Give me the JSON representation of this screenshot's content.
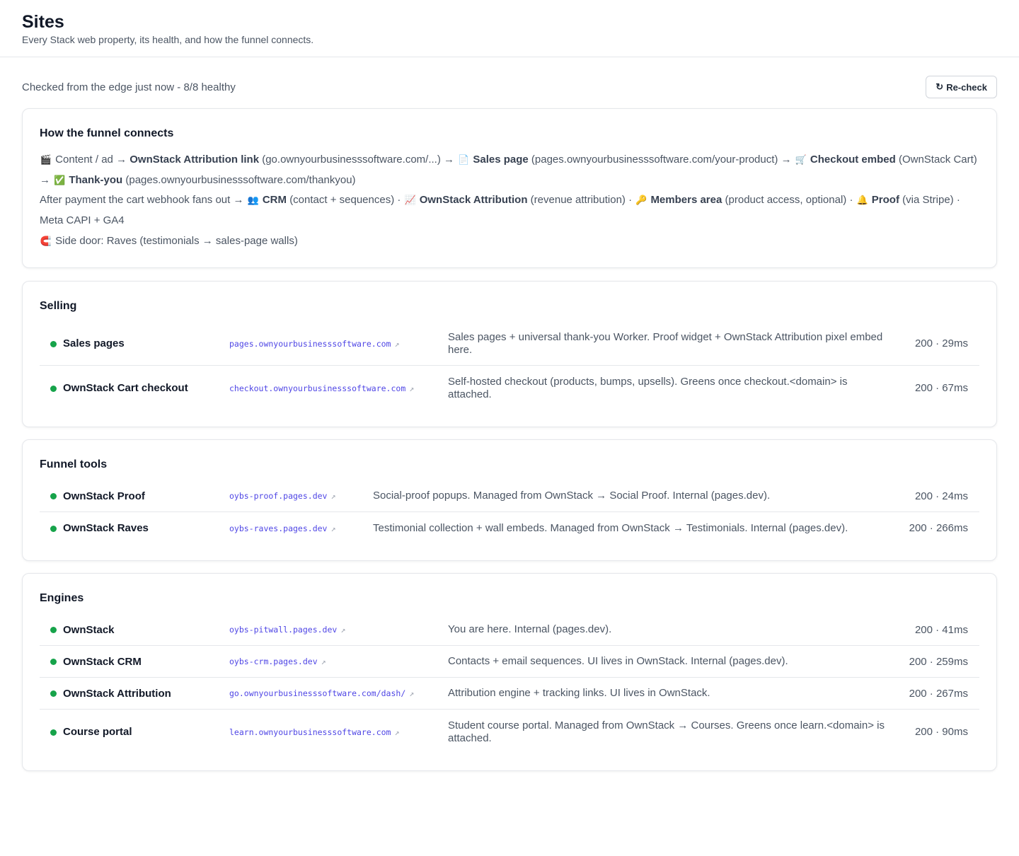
{
  "header": {
    "title": "Sites",
    "subtitle": "Every Stack web property, its health, and how the funnel connects."
  },
  "status": {
    "text": "Checked from the edge just now - 8/8 healthy",
    "recheck_label": "Re-check",
    "recheck_icon": "↻"
  },
  "funnel": {
    "title": "How the funnel connects",
    "l1_icon": "🎬",
    "l1_a": "Content / ad",
    "l1_b_bold": "OwnStack Attribution link",
    "l1_b_rest": "(go.ownyourbusinesssoftware.com/...)",
    "l1_c_icon": "📄",
    "l1_c_bold": "Sales page",
    "l1_c_rest": "(pages.ownyourbusinesssoftware.com/your-product)",
    "l1_d_icon": "🛒",
    "l1_d_bold": "Checkout embed",
    "l1_d_rest": "(OwnStack Cart)",
    "l1_e_icon": "✅",
    "l1_e_bold": "Thank-you",
    "l1_e_rest": "(pages.ownyourbusinesssoftware.com/thankyou)",
    "l2_a": "After payment the cart webhook fans out",
    "l2_b_icon": "👥",
    "l2_b_bold": "CRM",
    "l2_b_rest": "(contact + sequences)",
    "l2_c_icon": "📈",
    "l2_c_bold": "OwnStack Attribution",
    "l2_c_rest": "(revenue attribution)",
    "l2_d_icon": "🔑",
    "l2_d_bold": "Members area",
    "l2_d_rest": "(product access, optional)",
    "l2_e_icon": "🔔",
    "l2_e_bold": "Proof",
    "l2_e_rest": "(via Stripe)",
    "l2_f": "Meta CAPI + GA4",
    "l3_icon": "🧲",
    "l3_text": "Side door: Raves (testimonials → sales-page walls)"
  },
  "sections": {
    "selling": {
      "title": "Selling",
      "rows": [
        {
          "name": "Sales pages",
          "url": "pages.ownyourbusinesssoftware.com",
          "desc": "Sales pages + universal thank-you Worker. Proof widget + OwnStack Attribution pixel embed here.",
          "meta": "200 · 29ms"
        },
        {
          "name": "OwnStack Cart checkout",
          "url": "checkout.ownyourbusinesssoftware.com",
          "desc": "Self-hosted checkout (products, bumps, upsells). Greens once checkout.<domain> is attached.",
          "meta": "200 · 67ms"
        }
      ]
    },
    "tools": {
      "title": "Funnel tools",
      "rows": [
        {
          "name": "OwnStack Proof",
          "url": "oybs-proof.pages.dev",
          "desc": "Social-proof popups. Managed from OwnStack → Social Proof. Internal (pages.dev).",
          "meta": "200 · 24ms"
        },
        {
          "name": "OwnStack Raves",
          "url": "oybs-raves.pages.dev",
          "desc": "Testimonial collection + wall embeds. Managed from OwnStack → Testimonials. Internal (pages.dev).",
          "meta": "200 · 266ms"
        }
      ]
    },
    "engines": {
      "title": "Engines",
      "rows": [
        {
          "name": "OwnStack",
          "url": "oybs-pitwall.pages.dev",
          "desc": "You are here. Internal (pages.dev).",
          "meta": "200 · 41ms"
        },
        {
          "name": "OwnStack CRM",
          "url": "oybs-crm.pages.dev",
          "desc": "Contacts + email sequences. UI lives in OwnStack. Internal (pages.dev).",
          "meta": "200 · 259ms"
        },
        {
          "name": "OwnStack Attribution",
          "url": "go.ownyourbusinesssoftware.com/dash/",
          "desc": "Attribution engine + tracking links. UI lives in OwnStack.",
          "meta": "200 · 267ms"
        },
        {
          "name": "Course portal",
          "url": "learn.ownyourbusinesssoftware.com",
          "desc": "Student course portal. Managed from OwnStack → Courses. Greens once learn.<domain> is attached.",
          "meta": "200 · 90ms"
        }
      ]
    }
  },
  "link_icon": "↗",
  "arrow": "→",
  "sep": "·",
  "colors": {
    "healthy": "#16a34a",
    "link": "#4f46e5"
  }
}
